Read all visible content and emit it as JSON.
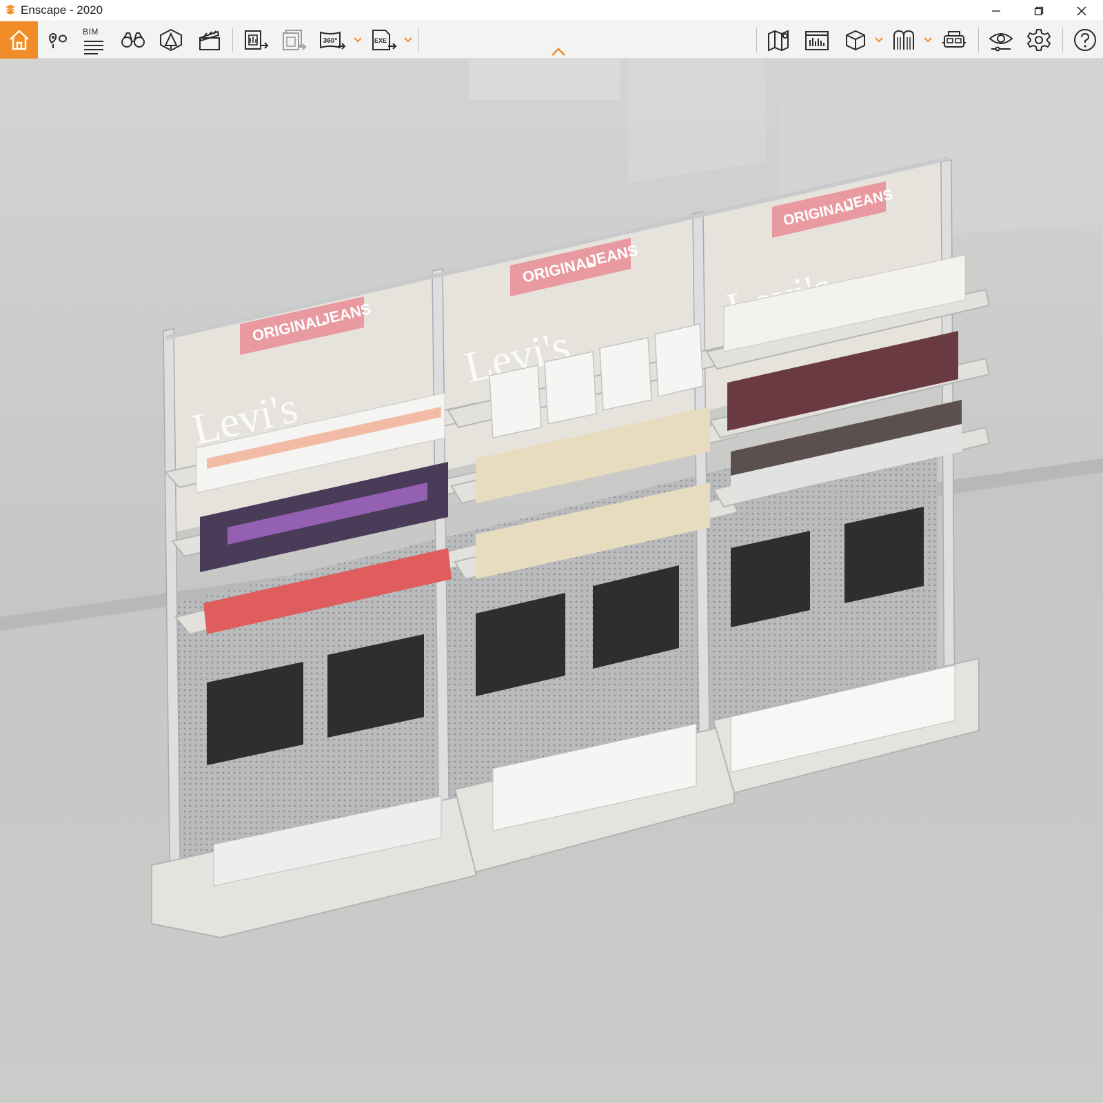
{
  "window": {
    "title": "Enscape - 2020",
    "controls": [
      "minimize",
      "restore",
      "close"
    ]
  },
  "toolbar": {
    "bim_label": "BIM",
    "left_tools": [
      {
        "name": "home",
        "icon": "home-icon",
        "active": true
      },
      {
        "name": "views",
        "icon": "map-pin-icon"
      },
      {
        "name": "bim",
        "icon": "bim-list-icon"
      },
      {
        "name": "walk-mode",
        "icon": "binoculars-icon"
      },
      {
        "name": "assets",
        "icon": "asset-library-icon"
      },
      {
        "name": "video-editor",
        "icon": "clapperboard-icon"
      },
      {
        "name": "render-image",
        "icon": "render-image-icon"
      },
      {
        "name": "batch-render",
        "icon": "batch-render-icon"
      },
      {
        "name": "panorama",
        "icon": "panorama-360-icon",
        "text": "360°"
      },
      {
        "name": "export-exe",
        "icon": "export-exe-icon",
        "text": "EXE"
      }
    ],
    "right_tools": [
      {
        "name": "map",
        "icon": "map-icon"
      },
      {
        "name": "screenshot",
        "icon": "screenshot-icon"
      },
      {
        "name": "view-cube",
        "icon": "cube-icon"
      },
      {
        "name": "materials",
        "icon": "arches-icon"
      },
      {
        "name": "vr-headset",
        "icon": "vr-headset-icon"
      },
      {
        "name": "visual-settings",
        "icon": "eye-icon"
      },
      {
        "name": "general-settings",
        "icon": "gear-icon"
      },
      {
        "name": "help",
        "icon": "help-icon"
      }
    ]
  },
  "scene": {
    "signs": [
      {
        "left_text": "ORIGINAL",
        "right_text": "JEANS"
      },
      {
        "left_text": "ORIGINAL",
        "right_text": "JEANS"
      },
      {
        "left_text": "ORIGINAL",
        "right_text": "JEANS"
      }
    ],
    "panel_lettering": [
      "Levi's",
      "Levi's",
      "Levi's"
    ],
    "colors": {
      "accent": "#f28c28",
      "sign": "#e99aa0",
      "wall": "#cfcfcd",
      "floor": "#c4c4c2",
      "frame": "#dcdedf"
    }
  }
}
